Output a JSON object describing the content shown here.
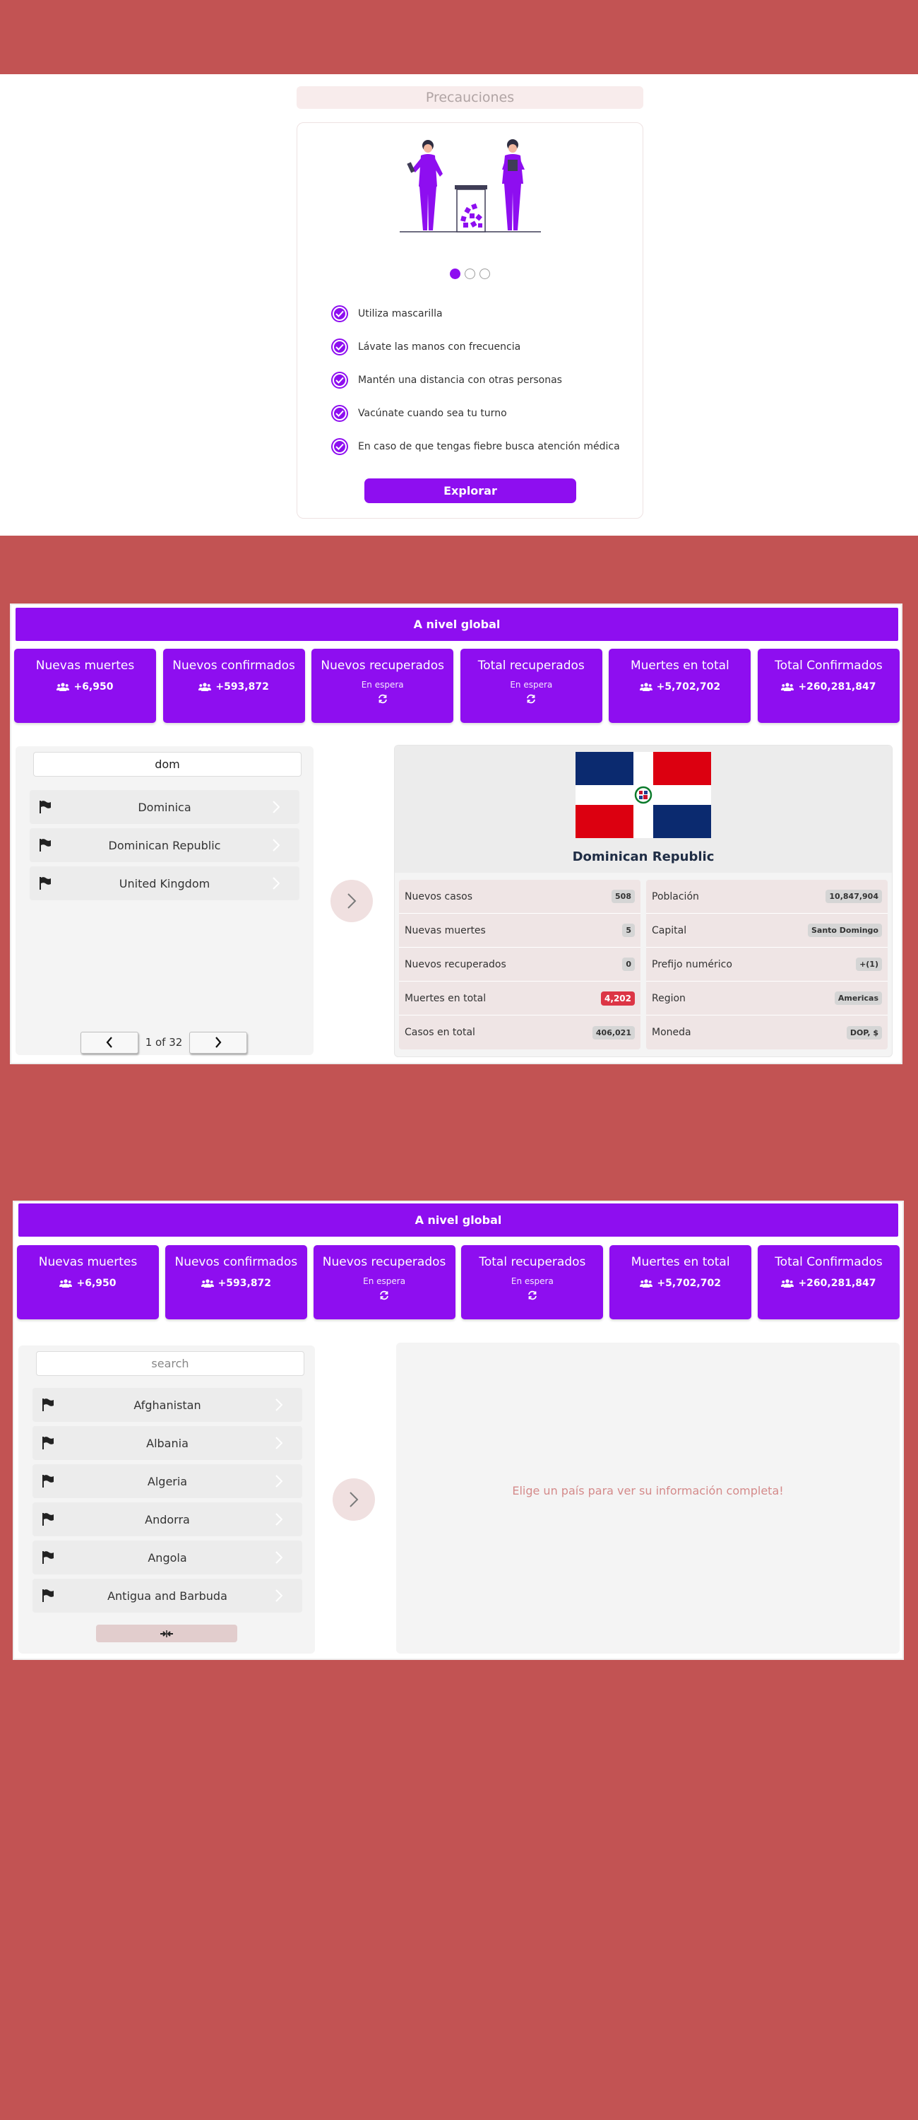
{
  "precautions": {
    "title": "Precauciones",
    "items": [
      "Utiliza mascarilla",
      "Lávate las manos con frecuencia",
      "Mantén una distancia con otras personas",
      "Vacúnate cuando sea tu turno",
      "En caso de que tengas fiebre busca atención médica"
    ],
    "explore_label": "Explorar",
    "carousel_active_index": 0,
    "carousel_count": 3
  },
  "global": {
    "title": "A nivel global",
    "stats": [
      {
        "label": "Nuevas muertes",
        "value": "+6,950",
        "icon": "users-icon"
      },
      {
        "label": "Nuevos confirmados",
        "value": "+593,872",
        "icon": "users-icon"
      },
      {
        "label": "Nuevos recuperados",
        "status": "En espera",
        "icon": "refresh-icon"
      },
      {
        "label": "Total recuperados",
        "status": "En espera",
        "icon": "refresh-icon"
      },
      {
        "label": "Muertes en total",
        "value": "+5,702,702",
        "icon": "users-icon"
      },
      {
        "label": "Total Confirmados",
        "value": "+260,281,847",
        "icon": "users-icon"
      }
    ]
  },
  "dashboard1": {
    "search_value": "dom",
    "countries": [
      "Dominica",
      "Dominican Republic",
      "United Kingdom"
    ],
    "pagination": "1 of 32",
    "selected": {
      "name": "Dominican Republic",
      "left": [
        {
          "label": "Nuevos casos",
          "value": "508"
        },
        {
          "label": "Nuevas muertes",
          "value": "5"
        },
        {
          "label": "Nuevos recuperados",
          "value": "0"
        },
        {
          "label": "Muertes en total",
          "value": "4,202"
        },
        {
          "label": "Casos en total",
          "value": "406,021"
        }
      ],
      "right": [
        {
          "label": "Población",
          "value": "10,847,904"
        },
        {
          "label": "Capital",
          "value": "Santo Domingo"
        },
        {
          "label": "Prefijo numérico",
          "value": "+(1)"
        },
        {
          "label": "Region",
          "value": "Americas"
        },
        {
          "label": "Moneda",
          "value": "DOP, $"
        }
      ]
    }
  },
  "dashboard2": {
    "search_placeholder": "search",
    "countries": [
      "Afghanistan",
      "Albania",
      "Algeria",
      "Andorra",
      "Angola",
      "Antigua and Barbuda"
    ],
    "empty_message": "Elige un país para ver su información completa!"
  },
  "colors": {
    "accent": "#8e0ef0",
    "background": "#c25353",
    "danger": "#dc3545"
  }
}
